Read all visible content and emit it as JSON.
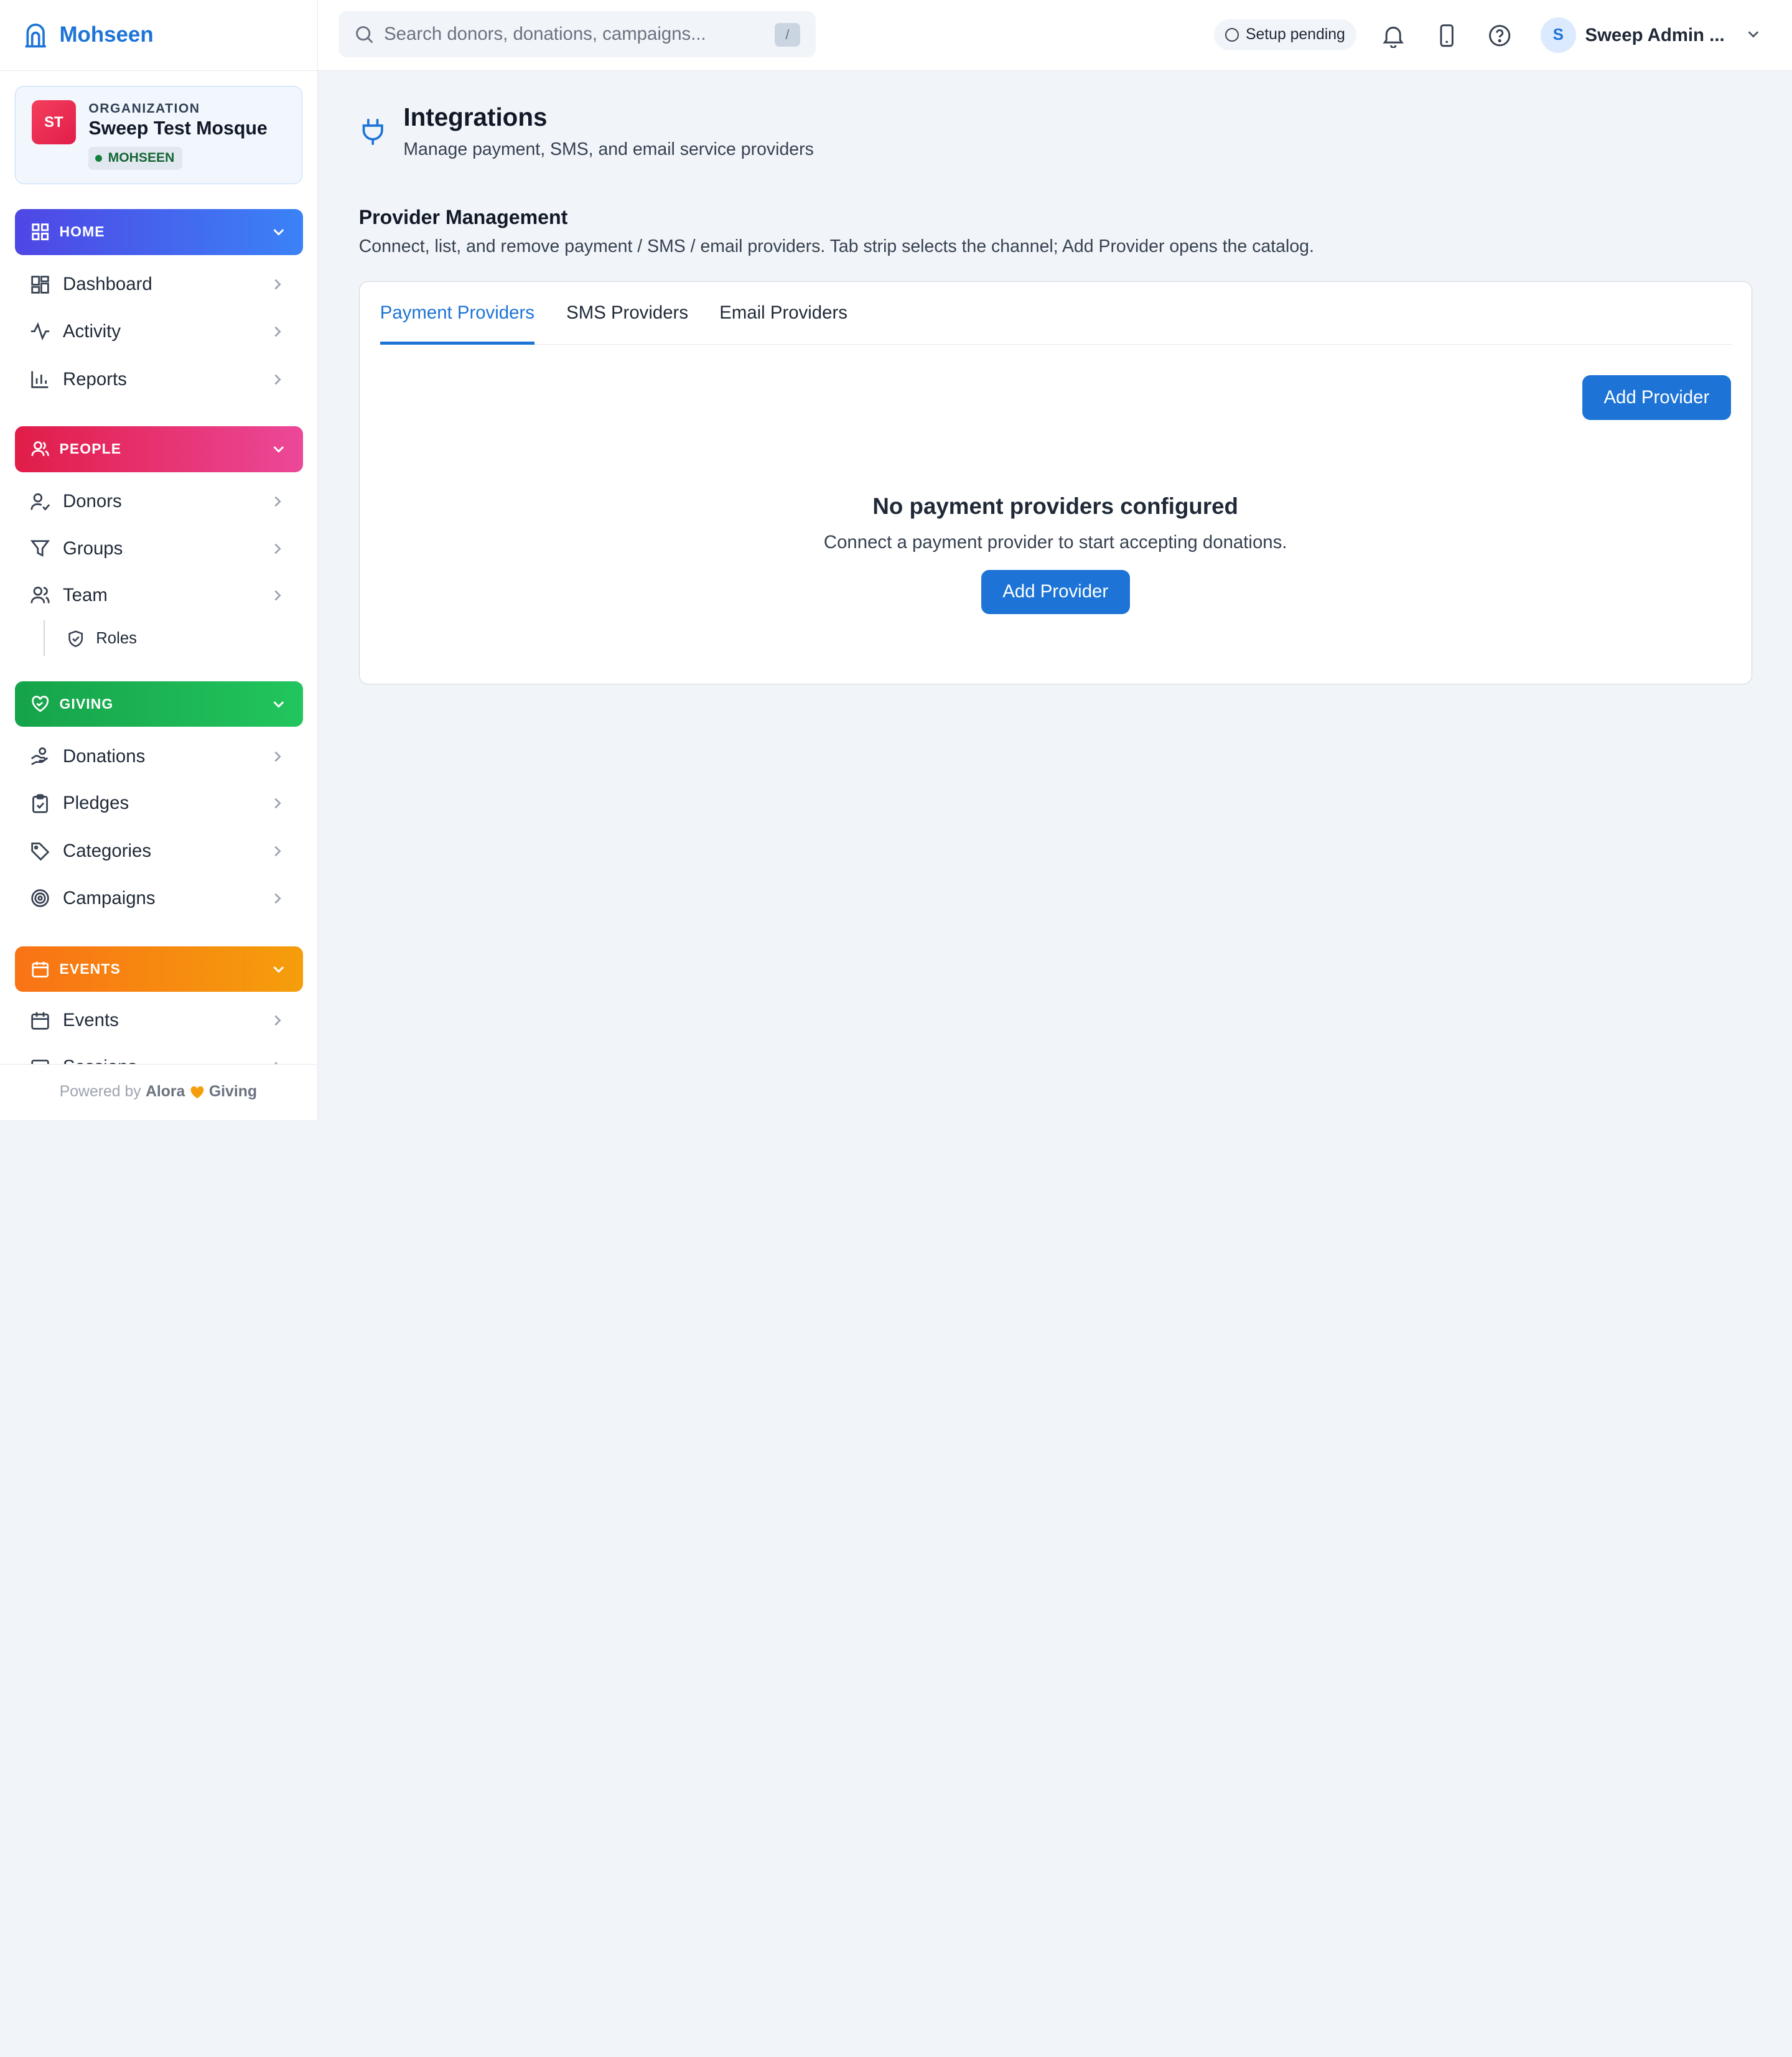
{
  "brand": {
    "name": "Mohseen"
  },
  "organization": {
    "avatar_text": "ST",
    "kicker": "ORGANIZATION",
    "name": "Sweep Test Mosque",
    "badge": "MOHSEEN"
  },
  "sidebar": {
    "sections": {
      "home": {
        "label": "HOME",
        "color_from": "#4f46e5",
        "color_to": "#3b82f6"
      },
      "people": {
        "label": "PEOPLE",
        "color_from": "#e11d48",
        "color_to": "#ec4899"
      },
      "giving": {
        "label": "GIVING",
        "color_from": "#16a34a",
        "color_to": "#22c55e"
      },
      "events": {
        "label": "EVENTS",
        "color_from": "#f97316",
        "color_to": "#f59e0b"
      }
    },
    "items": {
      "dashboard": "Dashboard",
      "activity": "Activity",
      "reports": "Reports",
      "donors": "Donors",
      "groups": "Groups",
      "team": "Team",
      "roles": "Roles",
      "donations": "Donations",
      "pledges": "Pledges",
      "categories": "Categories",
      "campaigns": "Campaigns",
      "events": "Events",
      "sessions": "Sessions"
    },
    "footer": {
      "prefix": "Powered by",
      "brand_a": "Alora",
      "brand_b": "Giving"
    }
  },
  "topbar": {
    "search_placeholder": "Search donors, donations, campaigns...",
    "search_shortcut": "/",
    "setup_status": "Setup pending",
    "user_initial": "S",
    "user_name": "Sweep Admin ..."
  },
  "page": {
    "title": "Integrations",
    "subtitle": "Manage payment, SMS, and email service providers",
    "section_title": "Provider Management",
    "section_desc": "Connect, list, and remove payment / SMS / email providers. Tab strip selects the channel; Add Provider opens the catalog."
  },
  "tabs": [
    {
      "label": "Payment Providers",
      "active": true
    },
    {
      "label": "SMS Providers",
      "active": false
    },
    {
      "label": "Email Providers",
      "active": false
    }
  ],
  "actions": {
    "add_provider": "Add Provider"
  },
  "empty_state": {
    "title": "No payment providers configured",
    "description": "Connect a payment provider to start accepting donations.",
    "button": "Add Provider"
  },
  "colors": {
    "accent": "#1d74d6",
    "heart": "#f59e0b"
  }
}
